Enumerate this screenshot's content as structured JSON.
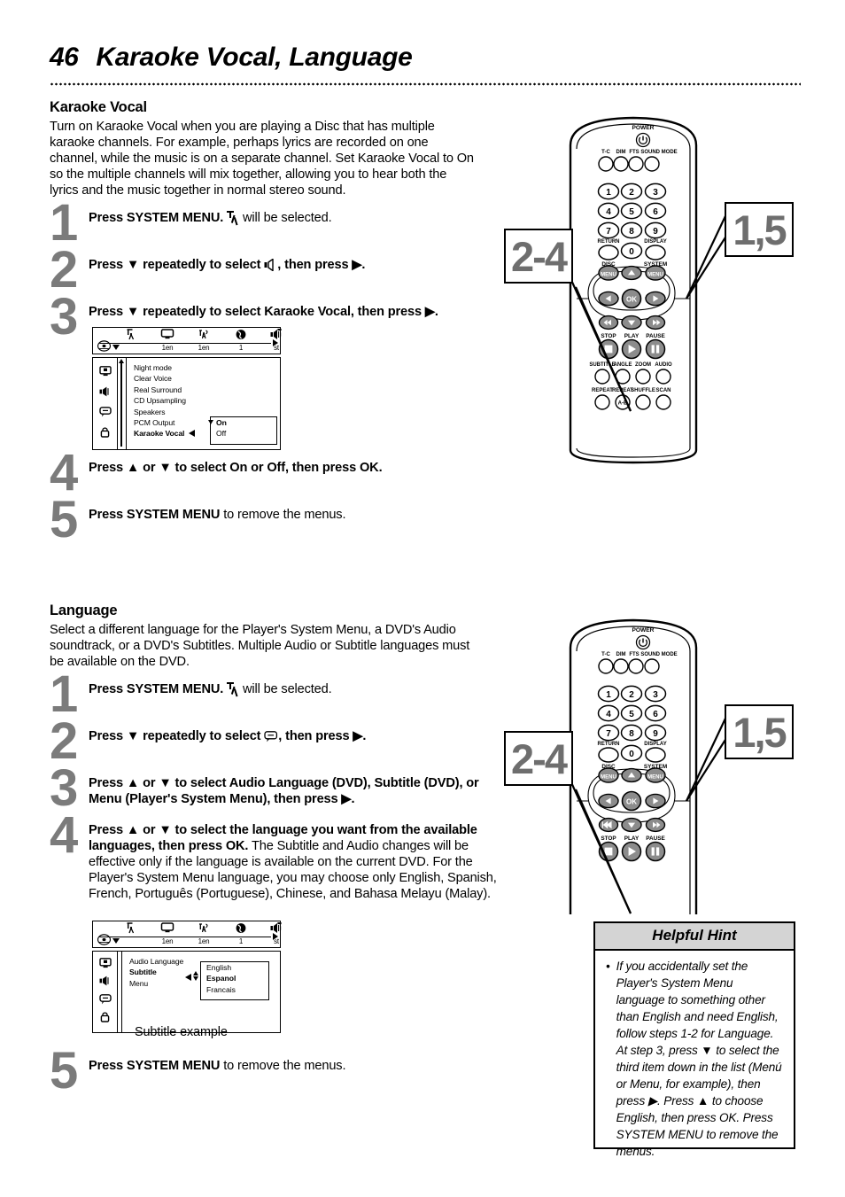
{
  "header": {
    "page_number": "46",
    "title": "Karaoke Vocal, Language"
  },
  "karaoke_section": {
    "heading": "Karaoke Vocal",
    "intro": "Turn on Karaoke Vocal when you are playing a Disc that has multiple karaoke channels. For example, perhaps lyrics are recorded on one channel, while the music is on a separate channel. Set Karaoke Vocal to On so the multiple channels will mix together, allowing you to hear both the lyrics and the music together in normal stereo sound.",
    "steps": [
      {
        "number": "1",
        "text_a": "Press SYSTEM MENU.",
        "icon": "picture-settings-icon",
        "text_b": "will be selected."
      },
      {
        "number": "2",
        "text_a": "Press ▼ repeatedly to select",
        "icon": "speaker-icon",
        "text_b": ", then press ▶."
      },
      {
        "number": "3",
        "text_a": "Press ▼ repeatedly to select Karaoke Vocal, then press ▶.",
        "icon": "",
        "text_b": ""
      },
      {
        "number": "4",
        "text_a": "Press ▲ or ▼ to select On or Off, then press OK.",
        "icon": "",
        "text_b": ""
      },
      {
        "number": "5",
        "text_a": "Press SYSTEM MENU",
        "icon": "",
        "text_b": "to remove the menus."
      }
    ]
  },
  "karaoke_osd": {
    "bar_icons": [
      {
        "name": "picture-settings-icon",
        "glyph": "Tʎ",
        "value": ""
      },
      {
        "name": "screen-icon",
        "glyph": "▭",
        "value": "1en"
      },
      {
        "name": "audio-language-icon",
        "glyph": "ɴғ",
        "value": "1en"
      },
      {
        "name": "globe-icon",
        "glyph": "⊕",
        "value": "1"
      },
      {
        "name": "sound-icon",
        "glyph": "✦",
        "value": "st"
      }
    ],
    "sidebar_icons": [
      "picture-icon",
      "speaker-icon",
      "subtitle-icon",
      "lock-icon"
    ],
    "list": [
      {
        "label": "Night mode",
        "selected": false
      },
      {
        "label": "Clear Voice",
        "selected": false
      },
      {
        "label": "Real Surround",
        "selected": false
      },
      {
        "label": "CD Upsampling",
        "selected": false
      },
      {
        "label": "Speakers",
        "selected": false
      },
      {
        "label": "PCM Output",
        "selected": false
      },
      {
        "label": "Karaoke Vocal",
        "selected": true
      }
    ],
    "submenu": [
      {
        "label": "On",
        "selected": true
      },
      {
        "label": "Off",
        "selected": false
      }
    ]
  },
  "language_section": {
    "heading": "Language",
    "intro": "Select a different language for the Player's System Menu, a DVD's Audio soundtrack, or a DVD's Subtitles. Multiple Audio or Subtitle languages must be available on the DVD.",
    "steps": [
      {
        "number": "1",
        "text_a": "Press SYSTEM MENU.",
        "icon": "picture-settings-icon",
        "text_b": "will be selected."
      },
      {
        "number": "2",
        "text_a": "Press ▼ repeatedly to select",
        "icon": "subtitle-icon",
        "text_b": ", then press ▶."
      },
      {
        "number": "3",
        "text_a": "Press ▲ or ▼ to select Audio Language (DVD), Subtitle (DVD), or Menu (Player's System Menu), then press ▶.",
        "icon": "",
        "text_b": ""
      },
      {
        "number": "4",
        "text_a": "Press ▲ or ▼ to select the language you want from the available languages, then press OK.",
        "icon": "",
        "text_b": " The Subtitle and Audio changes will be effective only if the language is available on the current DVD. For the Player's System Menu language, you may choose only English, Spanish, French, Português (Portuguese), Chinese, and Bahasa Melayu (Malay)."
      },
      {
        "number": "5",
        "text_a": "Press SYSTEM MENU",
        "icon": "",
        "text_b": "to remove the menus."
      }
    ]
  },
  "language_osd": {
    "bar_icons": [
      {
        "name": "picture-settings-icon",
        "glyph": "Tʎ",
        "value": ""
      },
      {
        "name": "screen-icon",
        "glyph": "▭",
        "value": "1en"
      },
      {
        "name": "audio-language-icon",
        "glyph": "ɴғ",
        "value": "1en"
      },
      {
        "name": "globe-icon",
        "glyph": "⊕",
        "value": "1"
      },
      {
        "name": "sound-icon",
        "glyph": "✦",
        "value": "st"
      }
    ],
    "sidebar_icons": [
      "picture-icon",
      "speaker-icon",
      "subtitle-icon",
      "lock-icon"
    ],
    "list": [
      {
        "label": "Audio Language",
        "selected": false
      },
      {
        "label": "Subtitle",
        "selected": true
      },
      {
        "label": "Menu",
        "selected": false
      }
    ],
    "submenu": [
      {
        "label": "English",
        "selected": false
      },
      {
        "label": "Espanol",
        "selected": true
      },
      {
        "label": "Francais",
        "selected": false
      }
    ],
    "caption": "Subtitle example"
  },
  "remote": {
    "power_label": "POWER",
    "top_row": [
      "T-C",
      "DIM",
      "FTS",
      "SOUND MODE"
    ],
    "keypad": [
      "1",
      "2",
      "3",
      "4",
      "5",
      "6",
      "7",
      "8",
      "9",
      "0"
    ],
    "return_label": "RETURN",
    "display_label": "DISPLAY",
    "disc_menu_label": "DISC",
    "disc_menu_button": "MENU",
    "system_menu_label": "SYSTEM",
    "system_menu_button": "MENU",
    "ok_label": "OK",
    "transport_labels": [
      "STOP",
      "PLAY",
      "PAUSE"
    ],
    "function_row_1": [
      "SUBTITLE",
      "ANGLE",
      "ZOOM",
      "AUDIO"
    ],
    "function_row_2": [
      "REPEAT",
      "REPEAT",
      "SHUFFLE",
      "SCAN"
    ],
    "repeat_ab_label": "A-B",
    "callout_left": "2-4",
    "callout_right": "1,5",
    "callout_color": "#6e6e6e"
  },
  "hint": {
    "title": "Helpful Hint",
    "bullet": "•",
    "text": "If you accidentally set the Player's System Menu language to something other than English and need English, follow steps 1-2 for Language. At step 3, press ▼ to select the third item down in the list (Menú or Menu, for example), then press ▶. Press ▲ to choose English, then press OK. Press SYSTEM MENU to remove the menus."
  }
}
